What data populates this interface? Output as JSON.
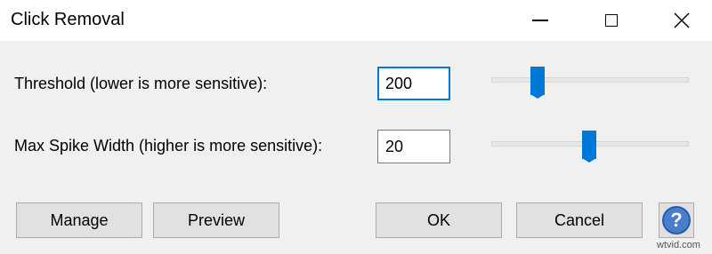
{
  "window": {
    "title": "Click Removal",
    "controls": {
      "minimize": "minimize-icon",
      "maximize": "maximize-icon",
      "close": "close-icon"
    }
  },
  "threshold": {
    "label": "Threshold (lower is more sensitive):",
    "value": "200",
    "slider_fraction": 0.22
  },
  "spike_width": {
    "label": "Max Spike Width (higher is more sensitive):",
    "value": "20",
    "slider_fraction": 0.49
  },
  "buttons": {
    "manage": "Manage",
    "preview": "Preview",
    "ok": "OK",
    "cancel": "Cancel",
    "help": "?"
  },
  "watermark": "wtvid.com",
  "colors": {
    "accent": "#0078d7",
    "help": "#4a7ccc"
  }
}
